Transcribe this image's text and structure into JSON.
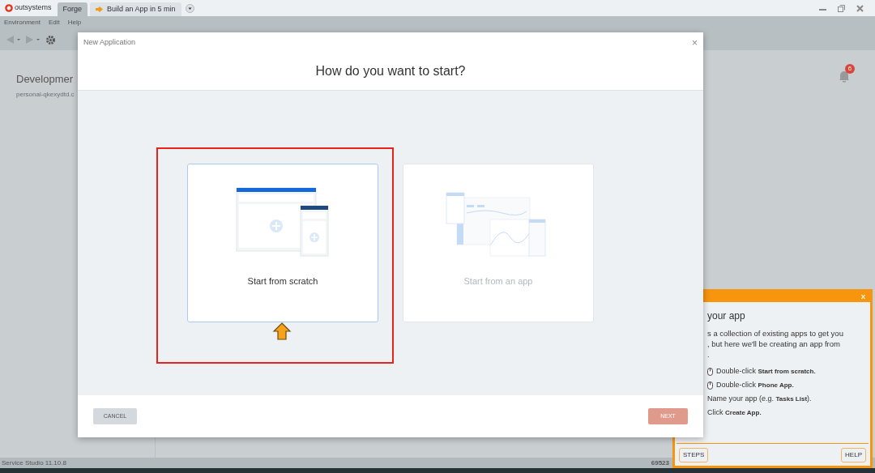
{
  "app": {
    "logo": "outsystems",
    "tabs": [
      {
        "label": "Forge",
        "selected": true,
        "kind": "plain"
      },
      {
        "label": "Build an App in 5 min",
        "selected": false,
        "kind": "tutorial"
      }
    ],
    "menu": [
      "Environment",
      "Edit",
      "Help"
    ],
    "environment_title": "Developmer",
    "environment_subtitle": "personal-qkexydtd.c",
    "notification_count": "6",
    "status_bar": {
      "version": "Service Studio 11.10.8",
      "field_2": "69523"
    }
  },
  "dialog": {
    "window_title": "New Application",
    "close": "×",
    "heading": "How do you want to start?",
    "options": [
      {
        "label": "Start from scratch",
        "selected": true,
        "disabled": false,
        "kind": "scratch"
      },
      {
        "label": "Start from an app",
        "selected": false,
        "disabled": true,
        "kind": "template"
      }
    ],
    "cancel": "CANCEL",
    "next": {
      "label": "NEXT",
      "disabled": true
    }
  },
  "tutorial": {
    "close": "X",
    "title": "your app",
    "intro": [
      "s a collection of existing apps to get you",
      ", but here we'll be creating an app from",
      "."
    ],
    "steps": [
      {
        "kind": "mouse",
        "text": "Double-click **Start from scratch.**"
      },
      {
        "kind": "mouse",
        "text": "Double-click **Phone App.**"
      },
      {
        "kind": "plain",
        "text": "Name your app (e.g. **Tasks List**)."
      },
      {
        "kind": "plain",
        "text": "Click **Create App.**"
      }
    ],
    "buttons": [
      "STEPS",
      "HELP"
    ]
  }
}
